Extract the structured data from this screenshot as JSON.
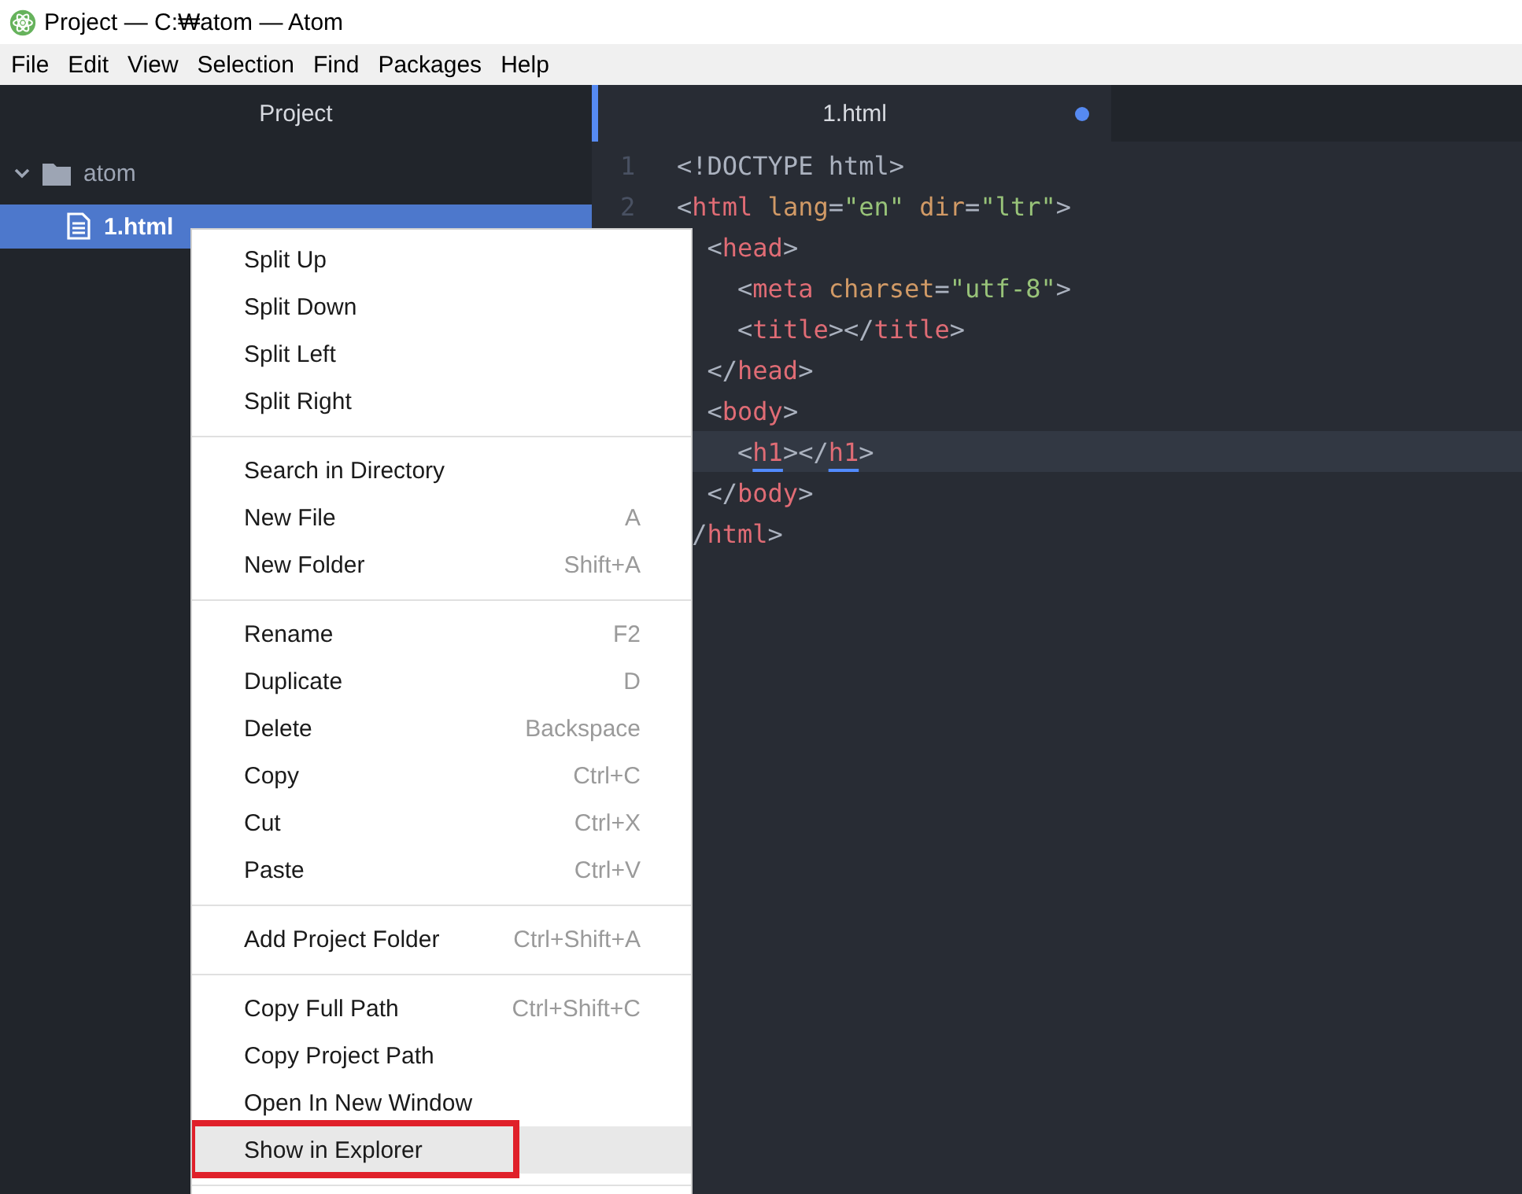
{
  "window": {
    "title": "Project — C:₩atom — Atom"
  },
  "menu_bar": [
    "File",
    "Edit",
    "View",
    "Selection",
    "Find",
    "Packages",
    "Help"
  ],
  "tree_view": {
    "title": "Project",
    "folder": {
      "name": "atom",
      "expanded": true,
      "children": [
        {
          "name": "1.html",
          "selected": true
        }
      ]
    }
  },
  "tabs": [
    {
      "label": "1.html",
      "selected": true,
      "modified": true
    }
  ],
  "editor": {
    "lines": [
      {
        "number": "1",
        "current": false,
        "tokens": [
          {
            "kind": "punct",
            "text": "<!DOCTYPE html>"
          }
        ]
      },
      {
        "number": "2",
        "current": false,
        "tokens": [
          {
            "kind": "punct",
            "text": "<"
          },
          {
            "kind": "tag",
            "text": "html"
          },
          {
            "kind": "attr",
            "text": " lang"
          },
          {
            "kind": "punct",
            "text": "="
          },
          {
            "kind": "string",
            "text": "\"en\""
          },
          {
            "kind": "attr",
            "text": " dir"
          },
          {
            "kind": "punct",
            "text": "="
          },
          {
            "kind": "string",
            "text": "\"ltr\""
          },
          {
            "kind": "punct",
            "text": ">"
          }
        ]
      },
      {
        "current": false,
        "tokens": [
          {
            "kind": "punct",
            "text": "  <"
          },
          {
            "kind": "tag",
            "text": "head"
          },
          {
            "kind": "punct",
            "text": ">"
          }
        ]
      },
      {
        "current": false,
        "tokens": [
          {
            "kind": "punct",
            "text": "    <"
          },
          {
            "kind": "tag",
            "text": "meta"
          },
          {
            "kind": "attr",
            "text": " charset"
          },
          {
            "kind": "punct",
            "text": "="
          },
          {
            "kind": "string",
            "text": "\"utf-8\""
          },
          {
            "kind": "punct",
            "text": ">"
          }
        ]
      },
      {
        "current": false,
        "tokens": [
          {
            "kind": "punct",
            "text": "    <"
          },
          {
            "kind": "tag",
            "text": "title"
          },
          {
            "kind": "punct",
            "text": "></"
          },
          {
            "kind": "tag",
            "text": "title"
          },
          {
            "kind": "punct",
            "text": ">"
          }
        ]
      },
      {
        "current": false,
        "tokens": [
          {
            "kind": "punct",
            "text": "  </"
          },
          {
            "kind": "tag",
            "text": "head"
          },
          {
            "kind": "punct",
            "text": ">"
          }
        ]
      },
      {
        "current": false,
        "tokens": [
          {
            "kind": "punct",
            "text": "  <"
          },
          {
            "kind": "tag",
            "text": "body"
          },
          {
            "kind": "punct",
            "text": ">"
          }
        ]
      },
      {
        "current": true,
        "tokens": [
          {
            "kind": "punct",
            "text": "    <"
          },
          {
            "kind": "matched-tag",
            "text": "h1"
          },
          {
            "kind": "punct",
            "text": "></"
          },
          {
            "kind": "matched-tag",
            "text": "h1"
          },
          {
            "kind": "punct",
            "text": ">"
          }
        ]
      },
      {
        "current": false,
        "tokens": [
          {
            "kind": "punct",
            "text": "  </"
          },
          {
            "kind": "tag",
            "text": "body"
          },
          {
            "kind": "punct",
            "text": ">"
          }
        ]
      },
      {
        "current": false,
        "tokens": [
          {
            "kind": "punct",
            "text": " /"
          },
          {
            "kind": "tag",
            "text": "html"
          },
          {
            "kind": "punct",
            "text": ">"
          }
        ]
      }
    ]
  },
  "context_menu": {
    "groups": [
      [
        {
          "label": "Split Up",
          "selected": false
        },
        {
          "label": "Split Down",
          "selected": false
        },
        {
          "label": "Split Left",
          "selected": false
        },
        {
          "label": "Split Right",
          "selected": false
        }
      ],
      [
        {
          "label": "Search in Directory",
          "selected": false
        },
        {
          "label": "New File",
          "shortcut": "A",
          "selected": false
        },
        {
          "label": "New Folder",
          "shortcut": "Shift+A",
          "selected": false
        }
      ],
      [
        {
          "label": "Rename",
          "shortcut": "F2",
          "selected": false
        },
        {
          "label": "Duplicate",
          "shortcut": "D",
          "selected": false
        },
        {
          "label": "Delete",
          "shortcut": "Backspace",
          "selected": false
        },
        {
          "label": "Copy",
          "shortcut": "Ctrl+C",
          "selected": false
        },
        {
          "label": "Cut",
          "shortcut": "Ctrl+X",
          "selected": false
        },
        {
          "label": "Paste",
          "shortcut": "Ctrl+V",
          "selected": false
        }
      ],
      [
        {
          "label": "Add Project Folder",
          "shortcut": "Ctrl+Shift+A",
          "selected": false
        }
      ],
      [
        {
          "label": "Copy Full Path",
          "shortcut": "Ctrl+Shift+C",
          "selected": false
        },
        {
          "label": "Copy Project Path",
          "selected": false
        },
        {
          "label": "Open In New Window",
          "selected": false
        },
        {
          "label": "Show in Explorer",
          "selected": true,
          "outlined": true
        }
      ]
    ]
  }
}
